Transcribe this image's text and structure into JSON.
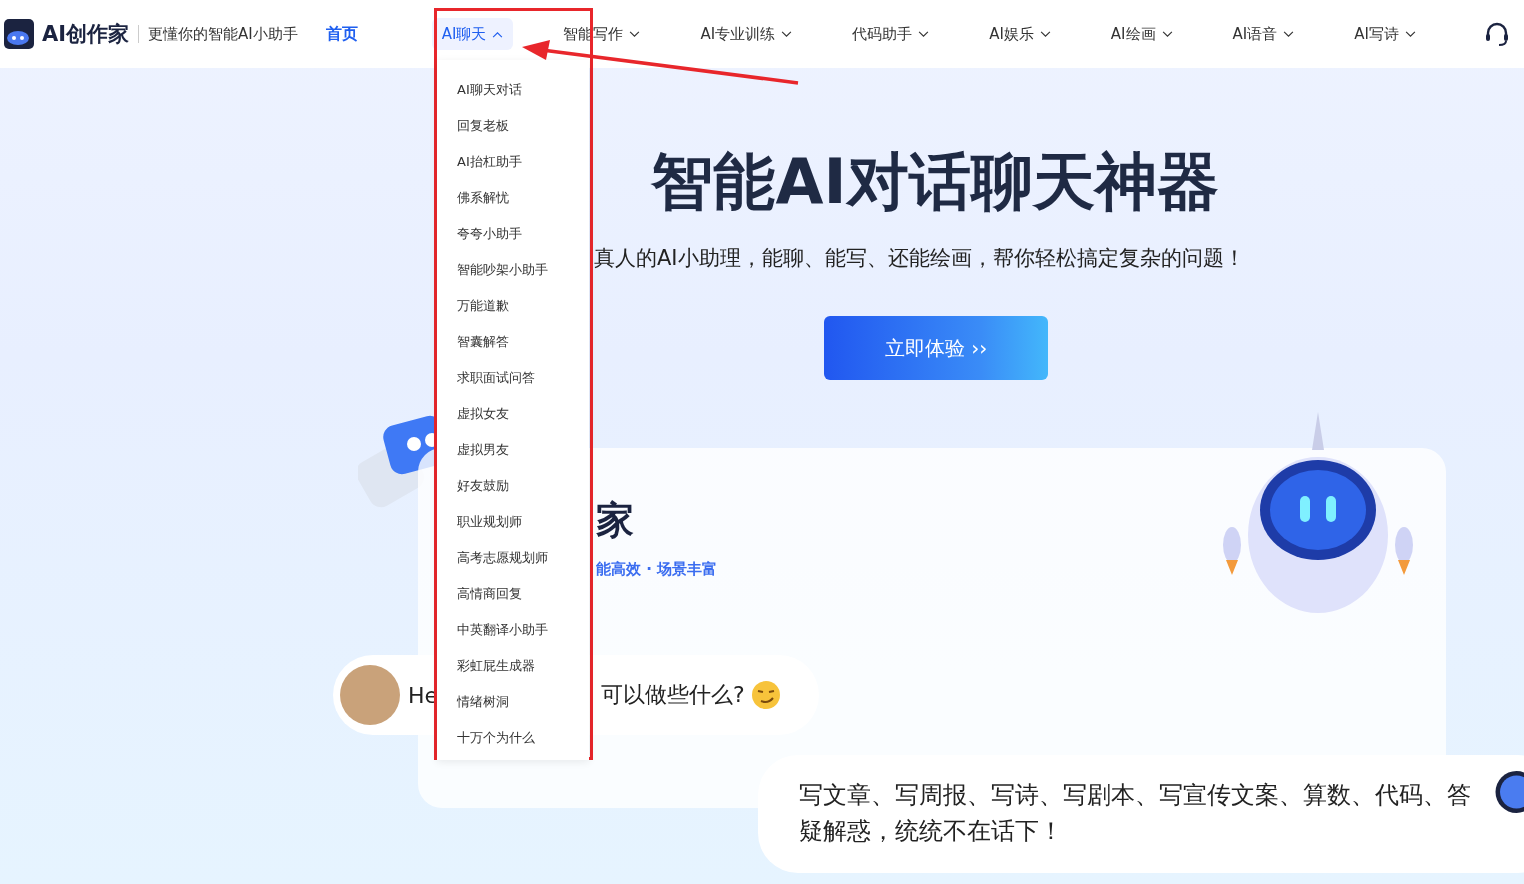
{
  "header": {
    "brand": "AI创作家",
    "tagline": "更懂你的智能AI小助手",
    "home_link": "首页",
    "nav": [
      {
        "label": "AI聊天",
        "selected": true,
        "expanded": true
      },
      {
        "label": "智能写作",
        "selected": false,
        "expanded": false
      },
      {
        "label": "AI专业训练",
        "selected": false,
        "expanded": false
      },
      {
        "label": "代码助手",
        "selected": false,
        "expanded": false
      },
      {
        "label": "AI娱乐",
        "selected": false,
        "expanded": false
      },
      {
        "label": "AI绘画",
        "selected": false,
        "expanded": false
      },
      {
        "label": "AI语音",
        "selected": false,
        "expanded": false
      },
      {
        "label": "AI写诗",
        "selected": false,
        "expanded": false
      }
    ]
  },
  "dropdown": {
    "items": [
      "AI聊天对话",
      "回复老板",
      "AI抬杠助手",
      "佛系解忧",
      "夸夸小助手",
      "智能吵架小助手",
      "万能道歉",
      "智囊解答",
      "求职面试问答",
      "虚拟女友",
      "虚拟男友",
      "好友鼓励",
      "职业规划师",
      "高考志愿规划师",
      "高情商回复",
      "中英翻译小助手",
      "彩虹屁生成器",
      "情绪树洞",
      "十万个为什么"
    ]
  },
  "hero": {
    "title": "智能AI对话聊天神器",
    "subtitle": "真人的AI小助理，能聊、能写、还能绘画，帮你轻松搞定复杂的问题！",
    "cta": "立即体验 ››"
  },
  "card": {
    "title": "家",
    "tags": "能高效 · 场景丰富"
  },
  "user_message": {
    "text_start": "He",
    "text_end": "可以做些什么?"
  },
  "assistant_message": {
    "text": "写文章、写周报、写诗、写剧本、写宣传文案、算数、代码、答疑解惑，统统不在话下！"
  }
}
